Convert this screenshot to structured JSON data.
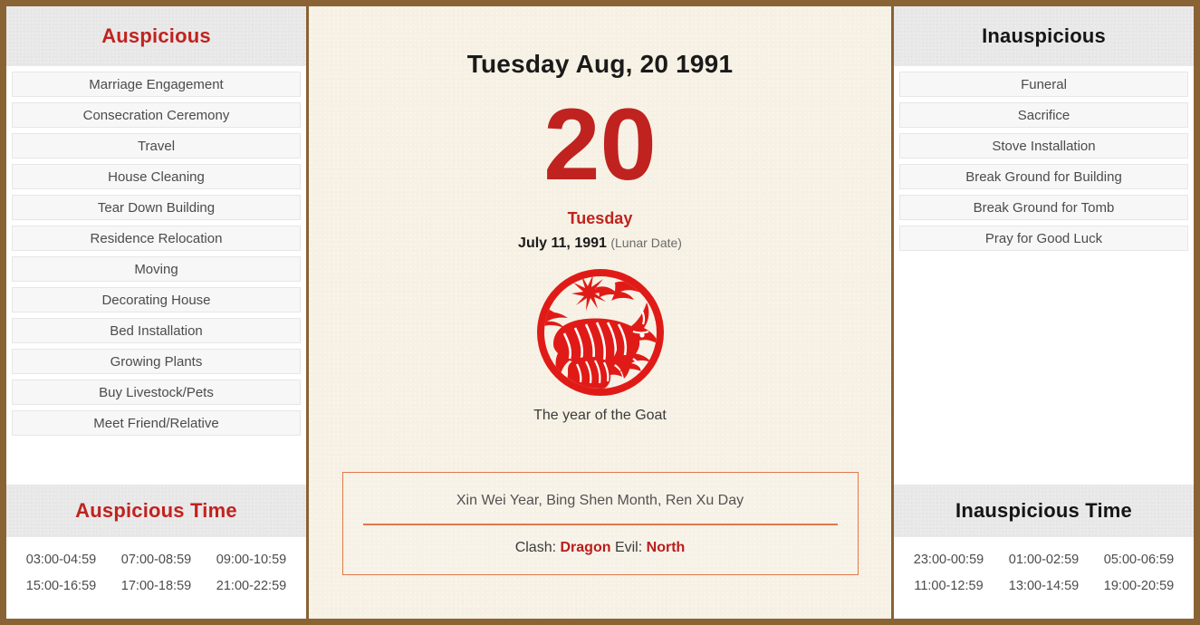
{
  "theme": {
    "frame_color": "#8a6334",
    "accent_red": "#c0231f",
    "paper_cream": "#f6f1e4",
    "panel_header_gray": "#e7e7e7",
    "info_box_border": "#e0784c",
    "highlight_red": "#b81d1d"
  },
  "left_panel": {
    "header_title": "Auspicious",
    "items": [
      "Marriage Engagement",
      "Consecration Ceremony",
      "Travel",
      "House Cleaning",
      "Tear Down Building",
      "Residence Relocation",
      "Moving",
      "Decorating House",
      "Bed Installation",
      "Growing Plants",
      "Buy Livestock/Pets",
      "Meet Friend/Relative"
    ],
    "time_header_title": "Auspicious Time",
    "times": [
      "03:00-04:59",
      "07:00-08:59",
      "09:00-10:59",
      "15:00-16:59",
      "17:00-18:59",
      "21:00-22:59"
    ]
  },
  "center_panel": {
    "gregorian_title": "Tuesday Aug, 20 1991",
    "big_day_number": "20",
    "weekday": "Tuesday",
    "lunar_date": "July 11, 1991",
    "lunar_tag": "(Lunar Date)",
    "zodiac_name": "goat-zodiac-papercut",
    "zodiac_caption": "The year of the Goat",
    "ganzhi_line": "Xin Wei Year, Bing Shen Month, Ren Xu Day",
    "clash_label": "Clash:",
    "clash_value": "Dragon",
    "evil_label": "Evil:",
    "evil_value": "North"
  },
  "right_panel": {
    "header_title": "Inauspicious",
    "items": [
      "Funeral",
      "Sacrifice",
      "Stove Installation",
      "Break Ground for Building",
      "Break Ground for Tomb",
      "Pray for Good Luck"
    ],
    "time_header_title": "Inauspicious Time",
    "times": [
      "23:00-00:59",
      "01:00-02:59",
      "05:00-06:59",
      "11:00-12:59",
      "13:00-14:59",
      "19:00-20:59"
    ]
  }
}
